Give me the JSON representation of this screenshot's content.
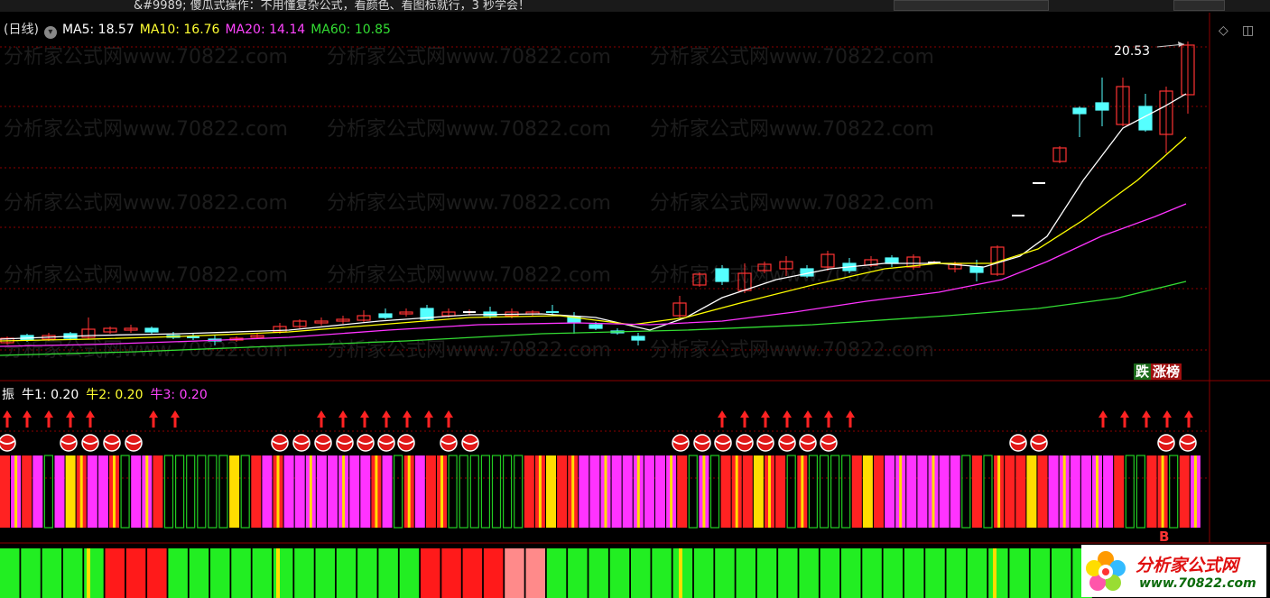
{
  "topbar": {
    "text": "&#9989; 傻瓜式操作：不用懂复杂公式，看颜色、看图标就行，3 秒学会！"
  },
  "header": {
    "period": "(日线)",
    "ma5": "MA5: 18.57",
    "ma10": "MA10: 16.76",
    "ma20": "MA20: 14.14",
    "ma60": "MA60: 10.85"
  },
  "colors": {
    "ma5": "#ffffff",
    "ma10": "#ffff00",
    "ma20": "#ff33ff",
    "ma60": "#33dd33",
    "up": "#ff3333",
    "down": "#55ffff",
    "grid": "#8b0000"
  },
  "main": {
    "peak_label": "20.53",
    "watermark": "分析家公式网www.70822.com",
    "rank": {
      "die": "跌",
      "zhang": "涨榜"
    }
  },
  "indicator": {
    "name": "振",
    "n1": "牛1: 0.20",
    "n2": "牛2: 0.20",
    "n3": "牛3: 0.20",
    "b_label": "B"
  },
  "logo": {
    "name": "分析家公式网",
    "url": "www.70822.com"
  },
  "icons": [
    "dropdown-icon",
    "diamond-icon",
    "panel-toggle-icon",
    "up-arrow-icon",
    "ball-icon"
  ]
}
